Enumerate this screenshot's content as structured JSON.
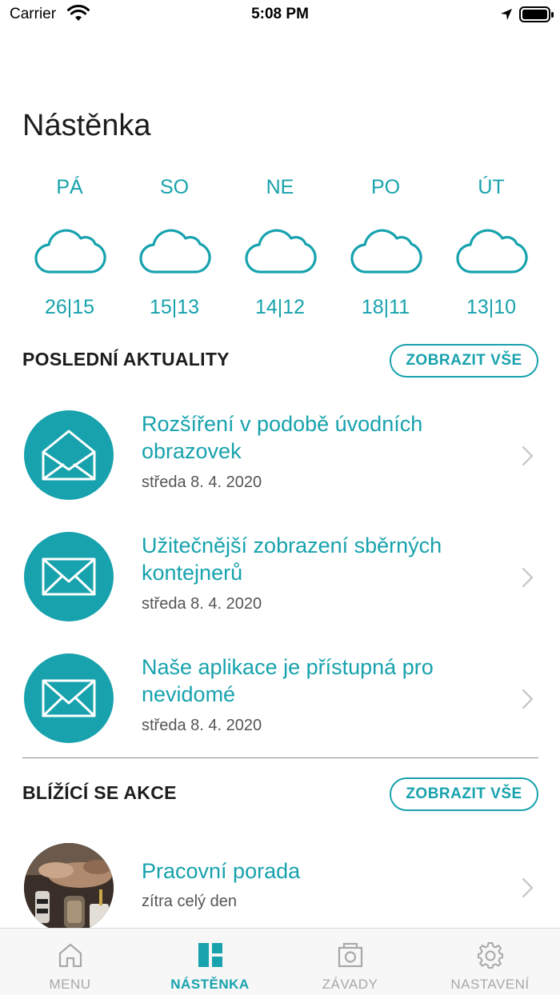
{
  "status_bar": {
    "carrier": "Carrier",
    "time": "5:08 PM"
  },
  "page_title": "Nástěnka",
  "weather": [
    {
      "day": "PÁ",
      "temps": "26|15",
      "icon": "cloud-icon"
    },
    {
      "day": "SO",
      "temps": "15|13",
      "icon": "cloud-icon"
    },
    {
      "day": "NE",
      "temps": "14|12",
      "icon": "cloud-icon"
    },
    {
      "day": "PO",
      "temps": "18|11",
      "icon": "cloud-icon"
    },
    {
      "day": "ÚT",
      "temps": "13|10",
      "icon": "cloud-icon"
    }
  ],
  "news": {
    "title": "POSLEDNÍ AKTUALITY",
    "show_all": "ZOBRAZIT VŠE",
    "items": [
      {
        "title": "Rozšíření v podobě úvodních obrazovek",
        "date": "středa 8. 4. 2020",
        "icon": "envelope-open-icon"
      },
      {
        "title": "Užitečnější zobrazení sběrných kontejnerů",
        "date": "středa 8. 4. 2020",
        "icon": "envelope-icon"
      },
      {
        "title": "Naše aplikace je přístupná pro nevidomé",
        "date": "středa 8. 4. 2020",
        "icon": "envelope-icon"
      }
    ]
  },
  "events": {
    "title": "BLÍŽÍCÍ SE AKCE",
    "show_all": "ZOBRAZIT VŠE",
    "items": [
      {
        "title": "Pracovní porada",
        "when": "zítra celý den"
      }
    ]
  },
  "tab_bar": {
    "tabs": [
      {
        "label": "MENU",
        "icon": "home-icon",
        "active": false
      },
      {
        "label": "NÁSTĚNKA",
        "icon": "dashboard-icon",
        "active": true
      },
      {
        "label": "ZÁVADY",
        "icon": "camera-icon",
        "active": false
      },
      {
        "label": "NASTAVENÍ",
        "icon": "gear-icon",
        "active": false
      }
    ]
  },
  "colors": {
    "accent": "#17a2ad",
    "text": "#1c1c1e",
    "muted": "#555555",
    "tab_inactive": "#a8a8a8"
  }
}
